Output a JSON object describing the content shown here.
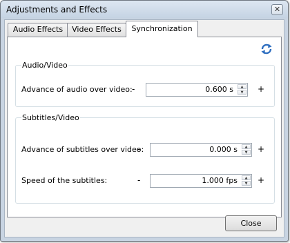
{
  "window": {
    "title": "Adjustments and Effects",
    "close_glyph": "✕"
  },
  "tabs": [
    {
      "label": "Audio Effects"
    },
    {
      "label": "Video Effects"
    },
    {
      "label": "Synchronization",
      "active": true
    }
  ],
  "sync": {
    "refresh_icon": "refresh-icon",
    "audio_video": {
      "title": "Audio/Video",
      "rows": [
        {
          "label": "Advance of audio over video:",
          "minus": "-",
          "value": "0.600 s",
          "plus": "+"
        }
      ]
    },
    "subtitles_video": {
      "title": "Subtitles/Video",
      "rows": [
        {
          "label": "Advance of subtitles over video:",
          "minus": "-",
          "value": "0.000 s",
          "plus": "+"
        },
        {
          "label": "Speed of the subtitles:",
          "minus": "-",
          "value": "1.000 fps",
          "plus": "+"
        }
      ]
    }
  },
  "footer": {
    "close_label": "Close"
  },
  "colors": {
    "accent_blue": "#2f6fc0",
    "title_bar": "#c8d4e2"
  }
}
